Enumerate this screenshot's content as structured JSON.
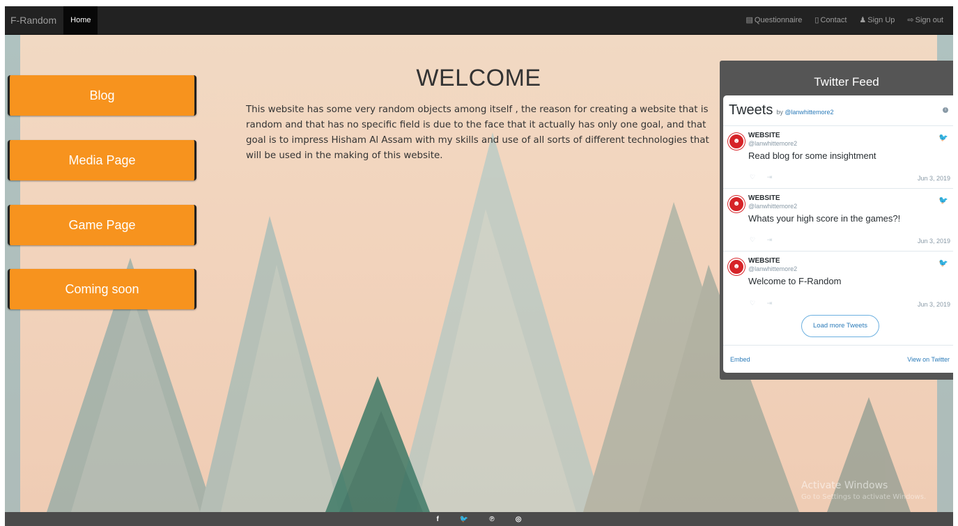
{
  "navbar": {
    "brand": "F-Random",
    "home": "Home",
    "links": [
      {
        "label": "Questionnaire",
        "icon": "list-icon"
      },
      {
        "label": "Contact",
        "icon": "phone-icon"
      },
      {
        "label": "Sign Up",
        "icon": "user-icon"
      },
      {
        "label": "Sign out",
        "icon": "sign-out-icon"
      }
    ]
  },
  "sidebar": {
    "items": [
      {
        "label": "Blog"
      },
      {
        "label": "Media Page"
      },
      {
        "label": "Game Page"
      },
      {
        "label": "Coming soon"
      }
    ]
  },
  "main": {
    "title": "WELCOME",
    "text": "This website has some very random objects among itself , the reason for creating a website that is random and that has no specific field is due to the face that it actually has only one goal, and that goal is to impress Hisham Al Assam with my skills and use of all sorts of different technologies that will be used in the making of this website."
  },
  "twitter": {
    "heading": "Twitter Feed",
    "tweets_label": "Tweets",
    "by_label": "by",
    "by_handle": "@lanwhittemore2",
    "items": [
      {
        "name": "WEBSITE",
        "handle": "@lanwhittemore2",
        "text": "Read blog for some insightment",
        "date": "Jun 3, 2019"
      },
      {
        "name": "WEBSITE",
        "handle": "@lanwhittemore2",
        "text": "Whats your high score in the games?!",
        "date": "Jun 3, 2019"
      },
      {
        "name": "WEBSITE",
        "handle": "@lanwhittemore2",
        "text": "Welcome to F-Random",
        "date": "Jun 3, 2019"
      }
    ],
    "load_more": "Load more Tweets",
    "embed": "Embed",
    "view_on": "View on Twitter"
  },
  "watermark": {
    "line1": "Activate Windows",
    "line2": "Go to Settings to activate Windows."
  },
  "footer": {
    "icons": [
      "facebook-icon",
      "twitter-icon",
      "pinterest-icon",
      "instagram-icon"
    ]
  },
  "colors": {
    "accent": "#f7931e",
    "navbar": "#222222",
    "footer": "#4b4b4b",
    "panel": "#555555"
  }
}
